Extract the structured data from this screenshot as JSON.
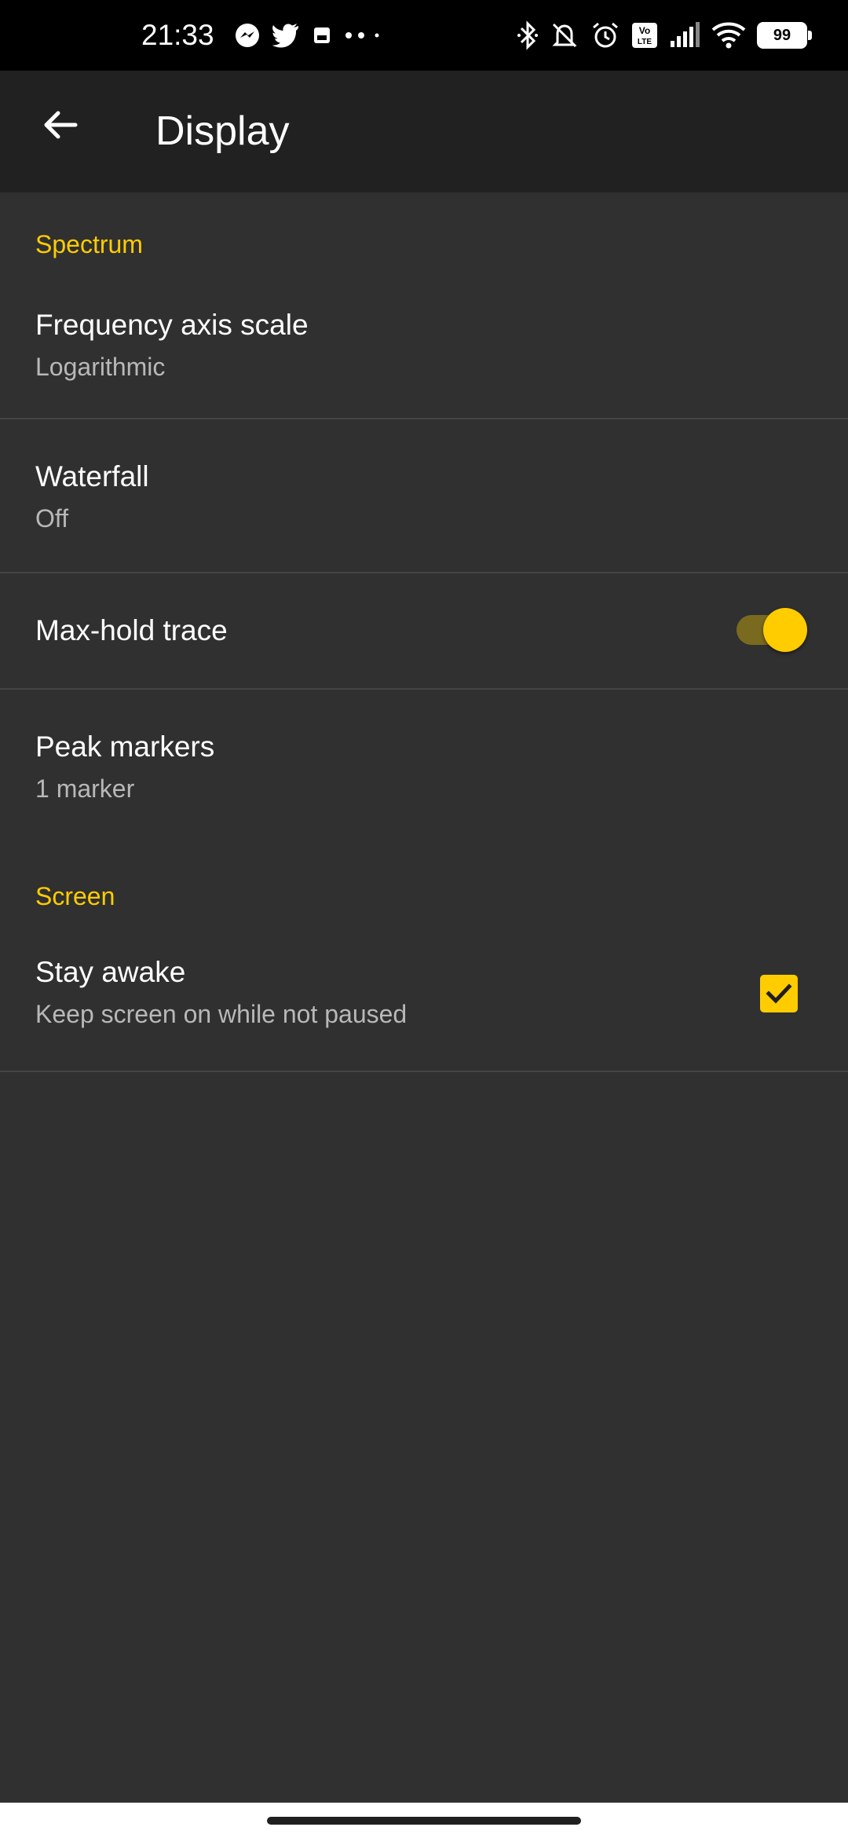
{
  "status_bar": {
    "time": "21:33",
    "battery": "99",
    "left_icons": [
      "messenger-icon",
      "twitter-icon",
      "notification-icon",
      "more-dots-icon"
    ],
    "right_icons": [
      "bluetooth-icon",
      "mute-bell-icon",
      "alarm-icon",
      "volte-icon",
      "signal-icon",
      "wifi-icon",
      "battery-icon"
    ]
  },
  "app_bar": {
    "title": "Display",
    "back_icon": "arrow-back-icon"
  },
  "sections": {
    "spectrum": {
      "header": "Spectrum",
      "frequency_axis_scale": {
        "title": "Frequency axis scale",
        "summary": "Logarithmic"
      },
      "waterfall": {
        "title": "Waterfall",
        "summary": "Off"
      },
      "max_hold_trace": {
        "title": "Max-hold trace",
        "enabled": true
      },
      "peak_markers": {
        "title": "Peak markers",
        "summary": "1 marker"
      }
    },
    "screen": {
      "header": "Screen",
      "stay_awake": {
        "title": "Stay awake",
        "summary": "Keep screen on while not paused",
        "checked": true
      }
    }
  },
  "colors": {
    "accent": "#ffcc00",
    "background": "#303030",
    "app_bar": "#212121",
    "status_bar": "#000000"
  }
}
